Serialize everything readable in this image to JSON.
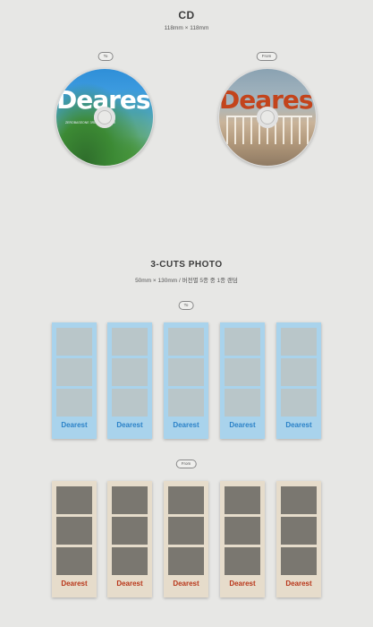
{
  "cd_section": {
    "title": "CD",
    "size": "118mm × 118mm",
    "discs": [
      {
        "tag": "To",
        "title": "Dearest",
        "caption": "ZEROBASEONE 3RD MINI ALBUM"
      },
      {
        "tag": "From",
        "title": "Dearest"
      }
    ]
  },
  "photo_section": {
    "title": "3-CUTS PHOTO",
    "size": "50mm × 130mm / 버전별 5종 중 1종 랜덤",
    "to_tag": "To",
    "from_tag": "From",
    "to_strips": [
      {
        "label": "Dearest"
      },
      {
        "label": "Dearest"
      },
      {
        "label": "Dearest"
      },
      {
        "label": "Dearest"
      },
      {
        "label": "Dearest"
      }
    ],
    "from_strips": [
      {
        "label": "Dearest"
      },
      {
        "label": "Dearest"
      },
      {
        "label": "Dearest"
      },
      {
        "label": "Dearest"
      },
      {
        "label": "Dearest"
      }
    ]
  },
  "colors": {
    "background": "#e7e7e5",
    "to_strip": "#a9d3ec",
    "to_label": "#2b82c8",
    "from_strip": "#e6dccb",
    "from_label": "#b8361a"
  }
}
